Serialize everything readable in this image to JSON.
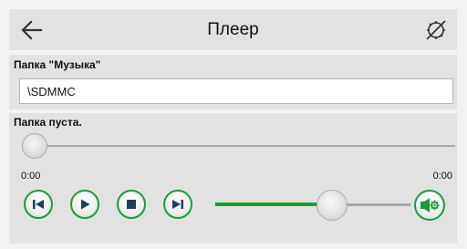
{
  "header": {
    "title": "Плеер",
    "back_icon": "arrow-left-icon",
    "right_icon": "settings-disabled-icon"
  },
  "folder": {
    "label": "Папка \"Музыка\"",
    "path_value": "\\SDMMC"
  },
  "player": {
    "status": "Папка пуста.",
    "seek_fraction": 0.0,
    "time_elapsed": "0:00",
    "time_total": "0:00",
    "volume_fraction": 0.6,
    "controls": [
      "skip-previous-icon",
      "play-icon",
      "stop-icon",
      "skip-next-icon"
    ],
    "volume_icon": "speaker-settings-icon"
  },
  "colors": {
    "accent": "#1a9d3a",
    "panel_bg": "#e2e2e2",
    "page_bg": "#f2f2f2"
  }
}
